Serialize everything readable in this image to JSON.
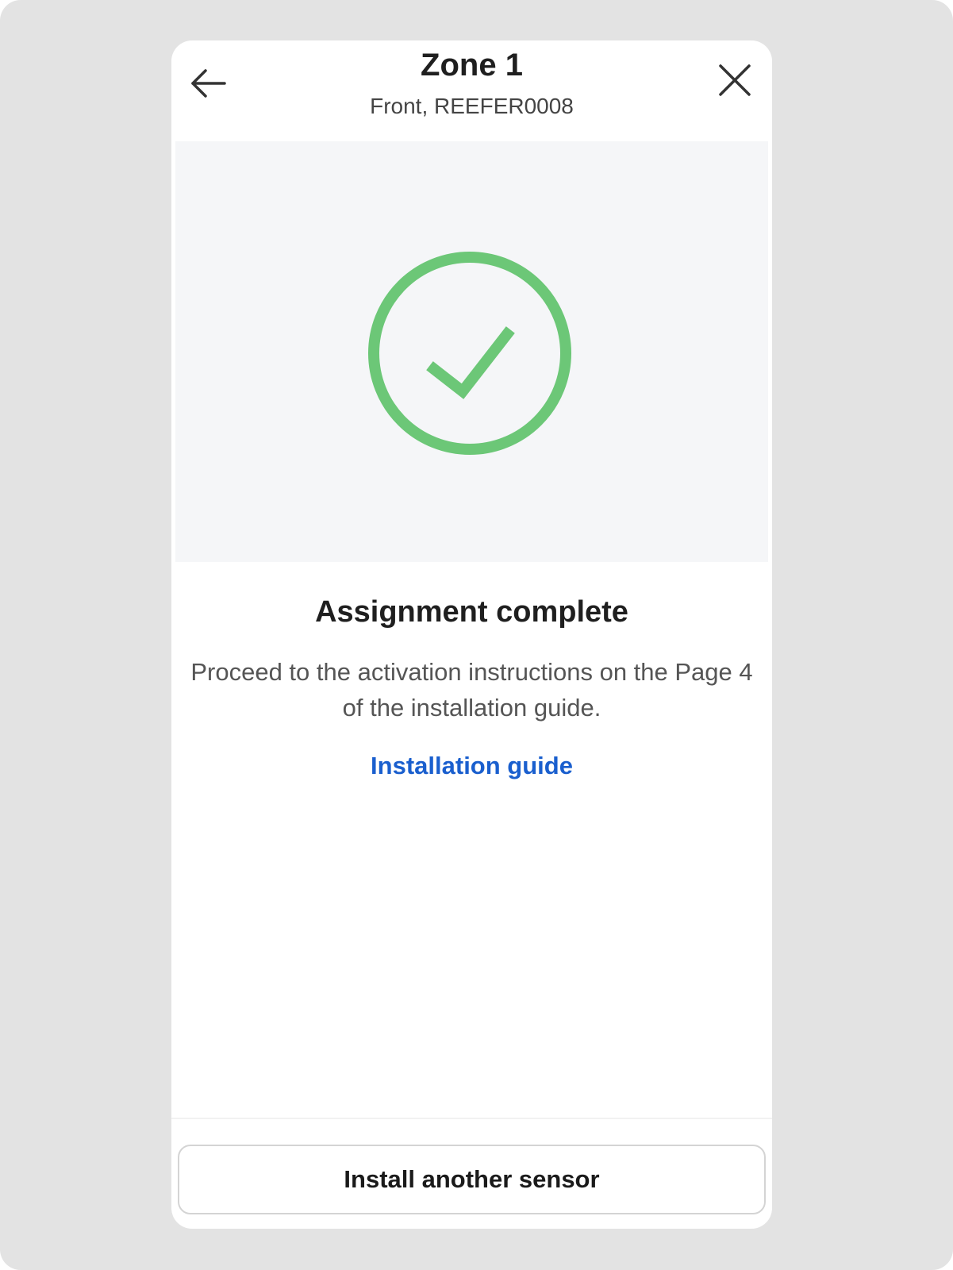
{
  "header": {
    "title": "Zone 1",
    "subtitle": "Front, REEFER0008",
    "back_icon": "arrow-left-icon",
    "close_icon": "close-icon"
  },
  "illustration": {
    "icon": "check-circle-icon",
    "accent_color": "#6cc777",
    "background_color": "#f5f6f8"
  },
  "content": {
    "heading": "Assignment complete",
    "body": "Proceed to the activation instructions on the Page 4 of the installation guide.",
    "link_label": "Installation guide",
    "link_color": "#1a5fce"
  },
  "footer": {
    "button_label": "Install another sensor"
  }
}
